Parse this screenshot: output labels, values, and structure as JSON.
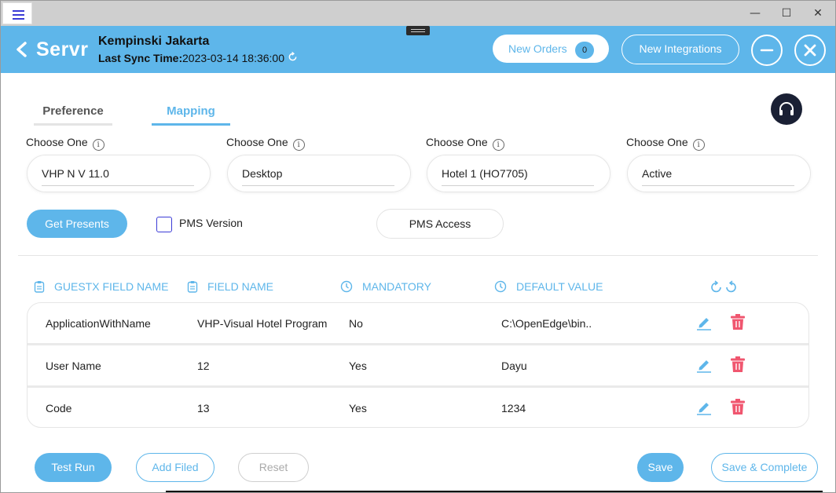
{
  "window": {
    "minimize": "—",
    "maximize": "☐",
    "close": "✕"
  },
  "header": {
    "logo": "Servr",
    "hotel_name": "Kempinski Jakarta",
    "sync_label": "Last Sync Time:",
    "sync_value": "2023-03-14 18:36:00",
    "new_orders_label": "New Orders",
    "new_orders_count": "0",
    "new_integrations_label": "New Integrations"
  },
  "tabs": [
    {
      "label": "Preference",
      "active": false
    },
    {
      "label": "Mapping",
      "active": true
    }
  ],
  "selects": [
    {
      "label": "Choose One",
      "value": "VHP N V 11.0"
    },
    {
      "label": "Choose One",
      "value": "Desktop"
    },
    {
      "label": "Choose One",
      "value": "Hotel 1 (HO7705)"
    },
    {
      "label": "Choose One",
      "value": "Active"
    }
  ],
  "actions": {
    "get_presents": "Get Presents",
    "pms_version": "PMS Version",
    "pms_access": "PMS Access"
  },
  "table": {
    "headers": [
      "GUESTX FIELD NAME",
      "FIELD NAME",
      "MANDATORY",
      "DEFAULT VALUE"
    ],
    "rows": [
      [
        "ApplicationWithName",
        "VHP-Visual Hotel Program",
        "No",
        "C:\\OpenEdge\\bin.."
      ],
      [
        "User Name",
        "12",
        "Yes",
        "Dayu"
      ],
      [
        "Code",
        "13",
        "Yes",
        "1234"
      ]
    ]
  },
  "footer": {
    "test_run": "Test Run",
    "add_field": "Add Filed",
    "reset": "Reset",
    "save": "Save",
    "save_complete": "Save & Complete"
  },
  "colors": {
    "accent": "#5eb6ea",
    "danger": "#f0566f",
    "dark": "#1a2034"
  }
}
